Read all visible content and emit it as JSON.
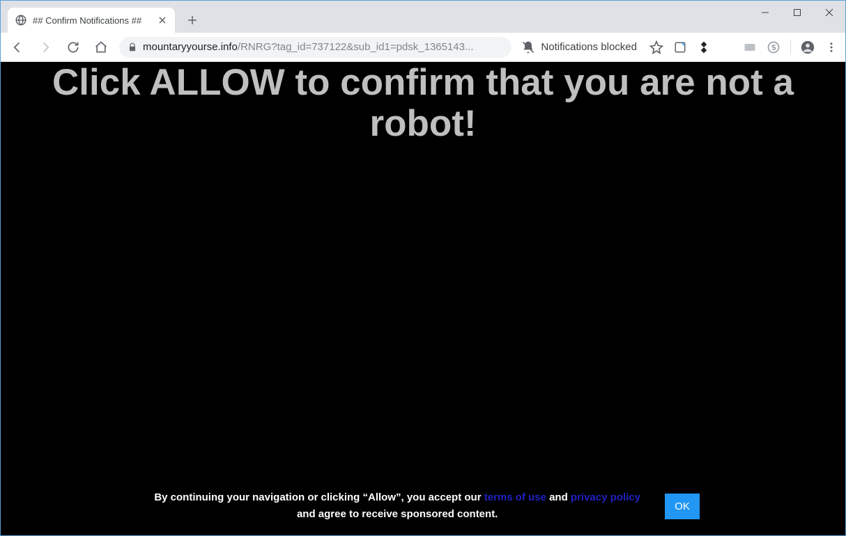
{
  "tab": {
    "title": "## Confirm Notifications ##"
  },
  "address": {
    "domain": "mountaryyourse.info",
    "path": "/RNRG?tag_id=737122&sub_id1=pdsk_1365143...",
    "notifications_status": "Notifications blocked"
  },
  "page": {
    "headline": "Click ALLOW to confirm that you are not a robot!",
    "consent_prefix": "By continuing your navigation or clicking “Allow”, you accept our ",
    "terms_label": "terms of use",
    "and_label": " and ",
    "privacy_label": "privacy policy",
    "consent_suffix": " and agree to receive sponsored content.",
    "ok_label": "OK"
  }
}
